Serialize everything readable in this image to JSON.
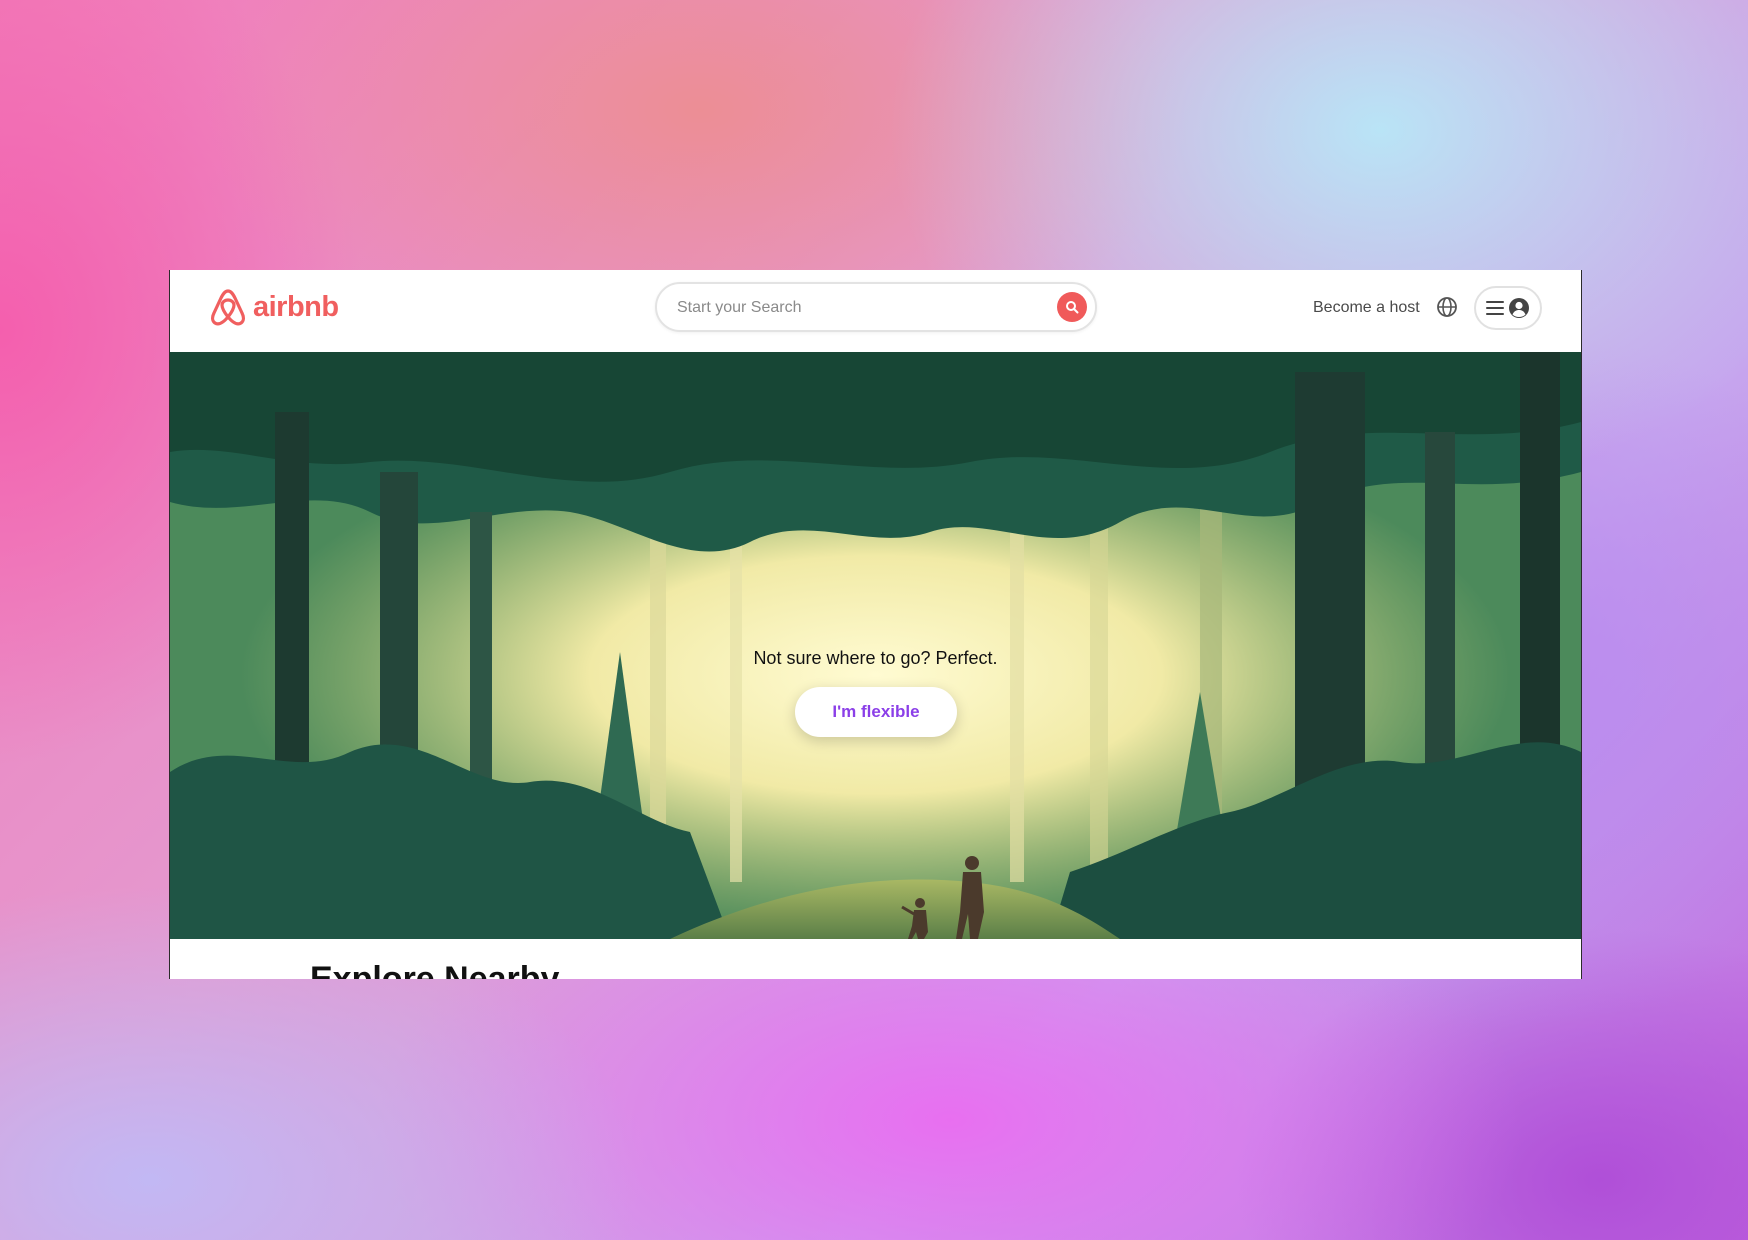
{
  "brand": {
    "name": "airbnb",
    "color": "#F05F5F"
  },
  "search": {
    "placeholder": "Start your Search",
    "value": "",
    "button_icon": "search-icon"
  },
  "nav": {
    "become_host": "Become a host",
    "globe_icon": "globe-icon",
    "menu_icon": "hamburger-menu-icon",
    "profile_icon": "user-avatar-icon"
  },
  "hero": {
    "tagline": "Not sure where to go? Perfect.",
    "cta_label": "I'm flexible",
    "cta_color": "#8B3FE8",
    "image": "illustrated forest with adult and child walking"
  },
  "section": {
    "title": "Explore Nearby"
  }
}
